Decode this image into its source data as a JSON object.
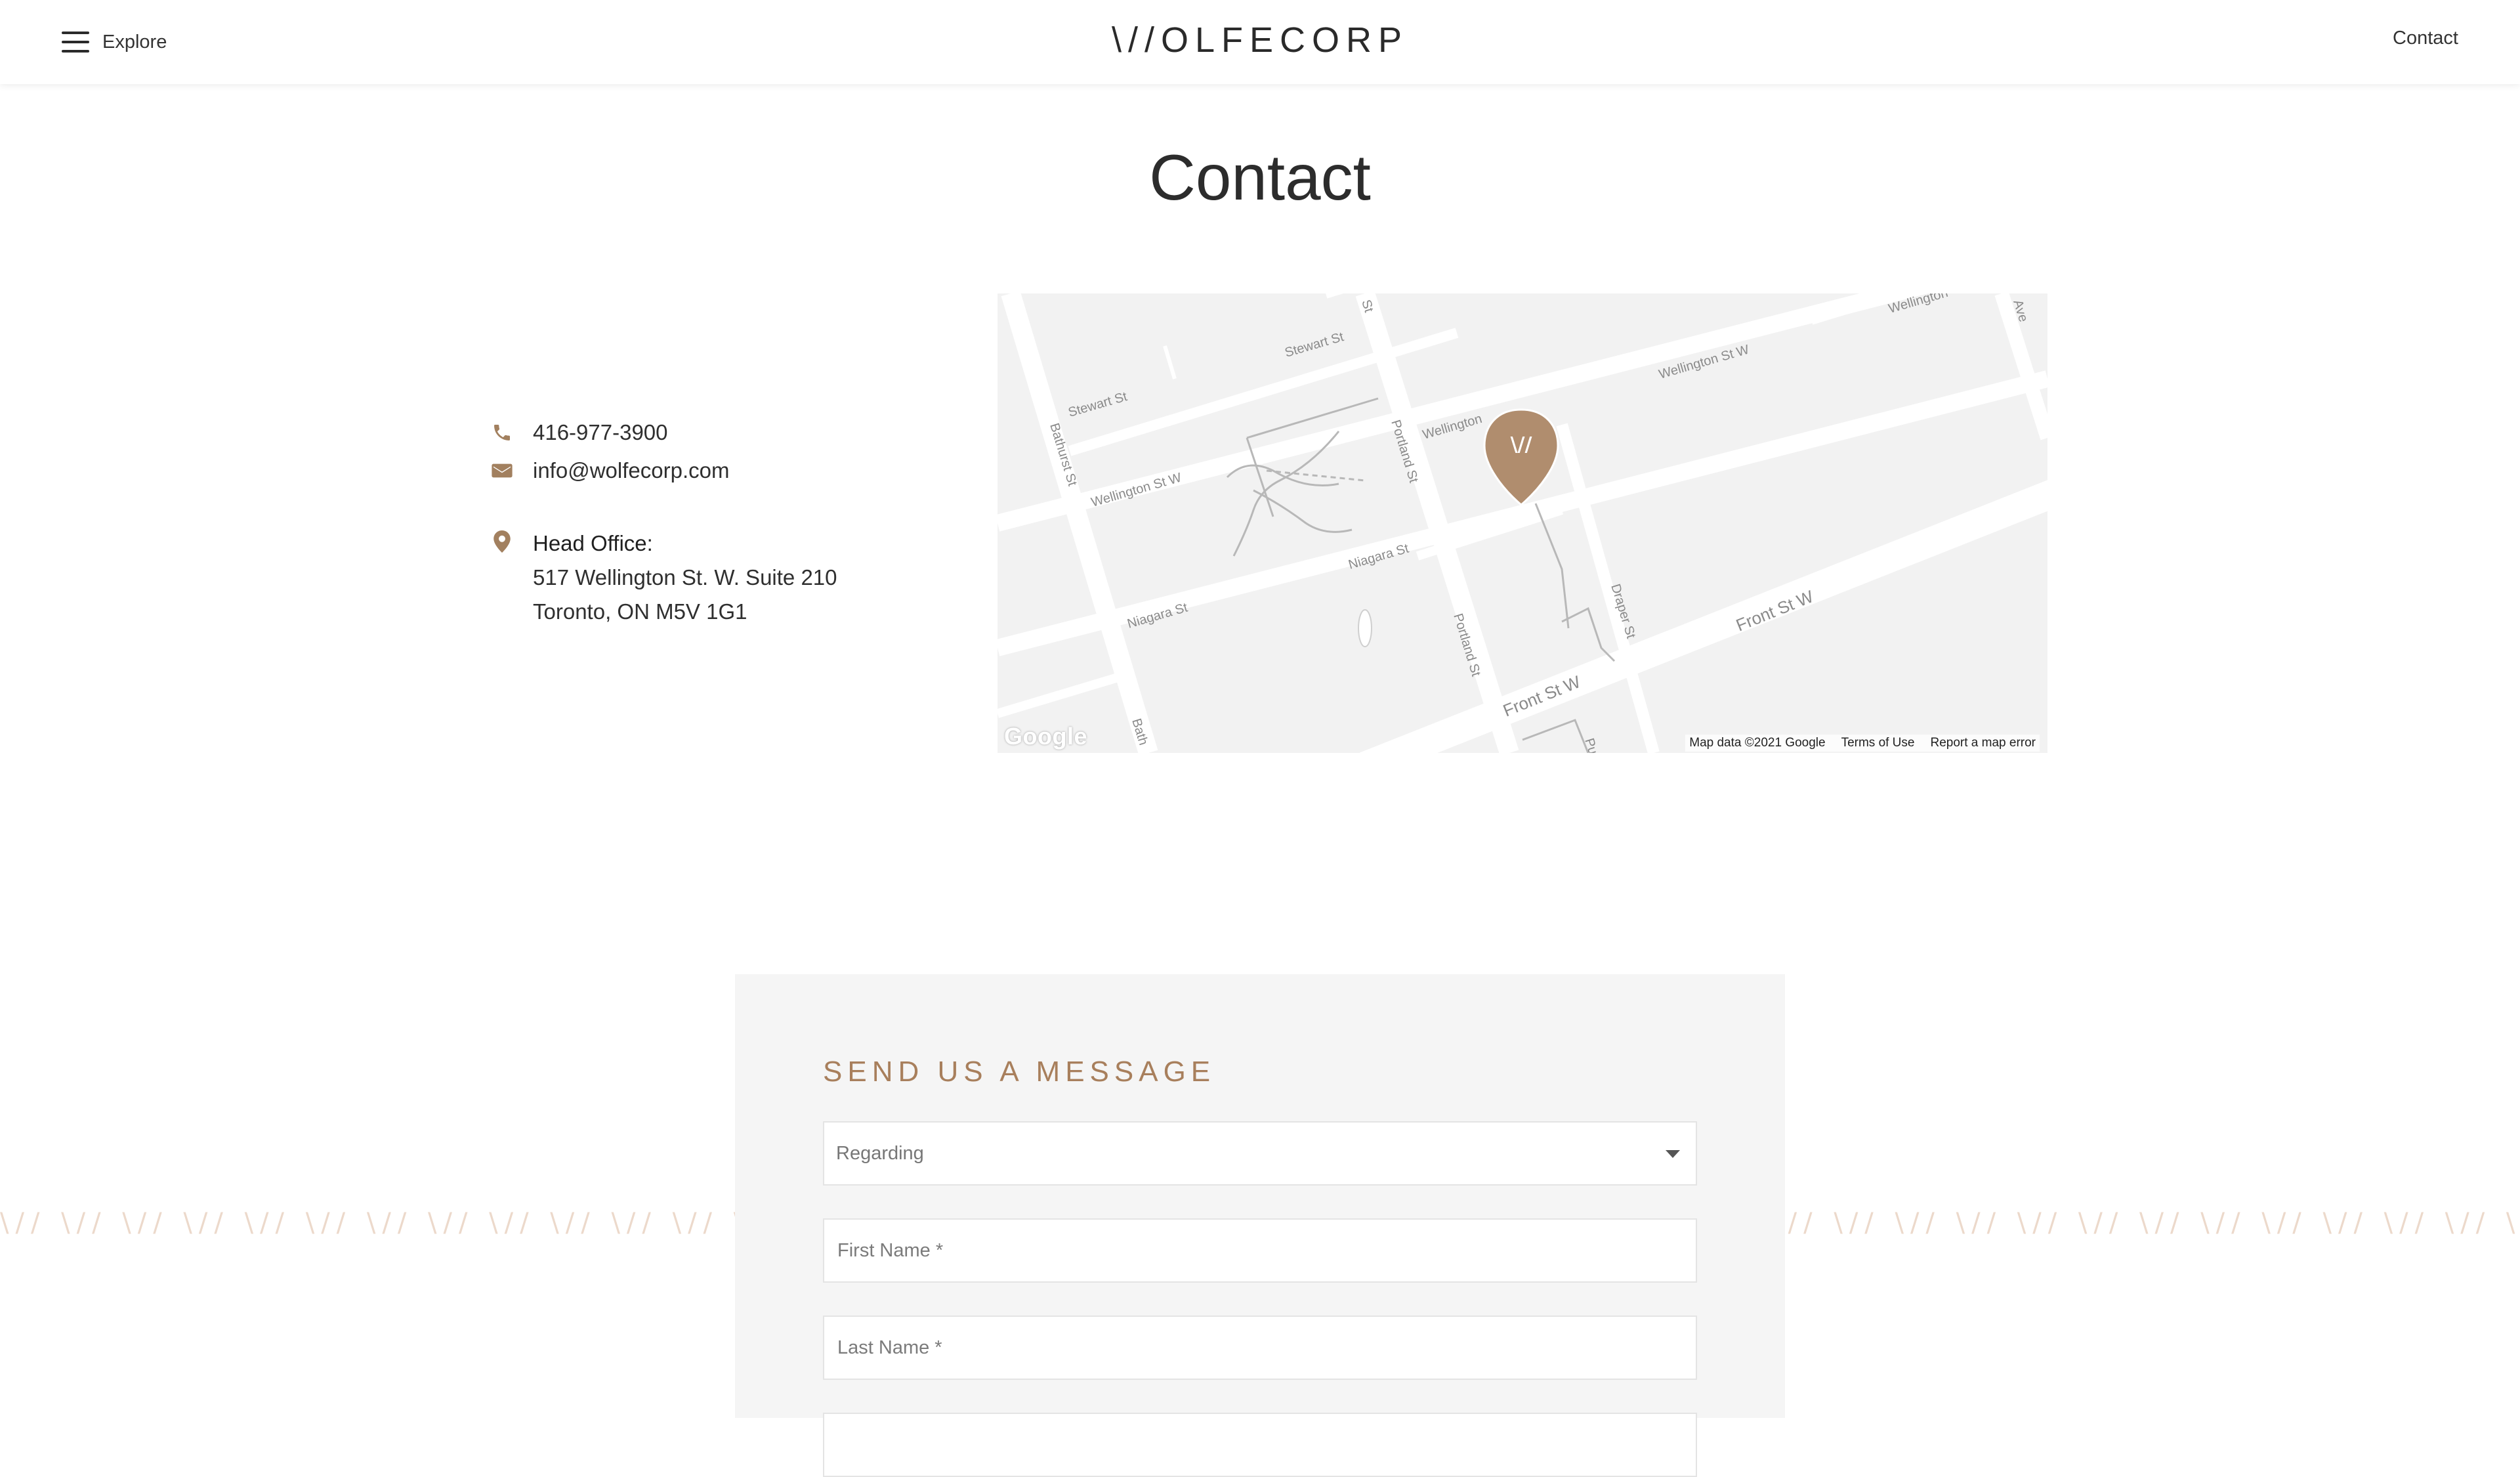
{
  "header": {
    "explore_label": "Explore",
    "logo_text": "\\//OLFECORP",
    "contact_link": "Contact"
  },
  "page": {
    "title": "Contact"
  },
  "contact_info": {
    "phone": "416-977-3900",
    "email": "info@wolfecorp.com",
    "office_label": "Head Office:",
    "address_line1": "517 Wellington St. W. Suite 210",
    "address_line2": "Toronto, ON M5V 1G1"
  },
  "map": {
    "streets": {
      "bathurst": "Bathurst St",
      "bathurst_bottom": "Bath",
      "stewart_left": "Stewart St",
      "stewart_right": "Stewart St",
      "wellington_left": "Wellington St W",
      "wellington_mid": "Wellington",
      "wellington_right": "Wellington St W",
      "wellington_top": "Wellington",
      "portland_top": "Portland St",
      "portland_bottom": "Portland St",
      "niagara_left": "Niagara St",
      "niagara_right": "Niagara St",
      "draper": "Draper St",
      "front_right": "Front St W",
      "front_left": "Front St W",
      "st_top": "St",
      "ave_top": "Ave",
      "pu": "Pu"
    },
    "marker_glyph": "\\//",
    "google_logo": "Google",
    "attribution": {
      "map_data": "Map data ©2021 Google",
      "terms": "Terms of Use",
      "report": "Report a map error"
    },
    "marker_color": "#b08d6e"
  },
  "pattern_text": "\\// \\// \\// \\// \\// \\// \\// \\// \\// \\// \\// \\// \\// \\// \\// \\// \\// \\// \\// \\// \\// \\// \\// \\// \\// \\// \\// \\// \\// \\// \\// \\// \\// \\// \\// \\// \\// \\// \\// \\// \\// \\// \\// \\// \\// \\// \\// \\// \\// \\// \\// \\// \\// \\// \\// \\// \\// \\// \\// \\// \\// \\// \\// \\// \\//",
  "form": {
    "title": "SEND US A MESSAGE",
    "regarding_label": "Regarding",
    "first_name_placeholder": "First Name *",
    "last_name_placeholder": "Last Name *"
  },
  "colors": {
    "accent": "#a87f5c",
    "icon": "#a2805f",
    "pattern": "#ecd9cb",
    "card_bg": "#f5f5f5"
  }
}
